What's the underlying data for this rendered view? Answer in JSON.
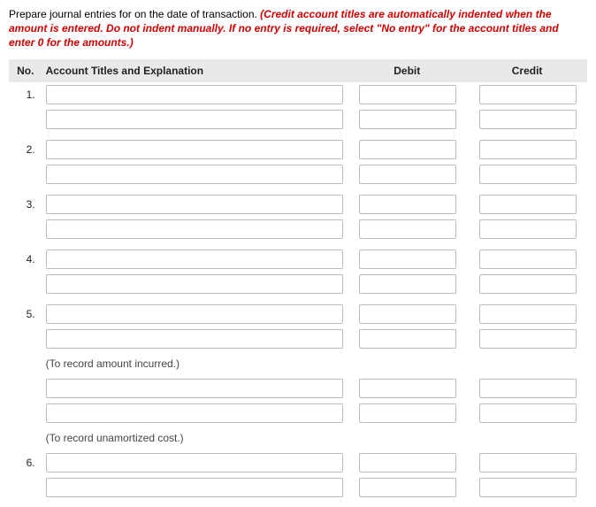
{
  "instructions": {
    "lead": "Prepare journal entries for on the date of transaction. ",
    "emph": "(Credit account titles are automatically indented when the amount is entered. Do not indent manually. If no entry is required, select \"No entry\" for the account titles and enter 0 for the amounts.)"
  },
  "headers": {
    "no": "No.",
    "account": "Account Titles and Explanation",
    "debit": "Debit",
    "credit": "Credit"
  },
  "rows": [
    {
      "no": "1.",
      "type": "entry"
    },
    {
      "type": "entry"
    },
    {
      "type": "spacer"
    },
    {
      "no": "2.",
      "type": "entry"
    },
    {
      "type": "entry"
    },
    {
      "type": "spacer"
    },
    {
      "no": "3.",
      "type": "entry"
    },
    {
      "type": "entry"
    },
    {
      "type": "spacer"
    },
    {
      "no": "4.",
      "type": "entry"
    },
    {
      "type": "entry"
    },
    {
      "type": "spacer"
    },
    {
      "no": "5.",
      "type": "entry"
    },
    {
      "type": "entry"
    },
    {
      "type": "note",
      "text": "(To record amount incurred.)"
    },
    {
      "type": "entry"
    },
    {
      "type": "entry"
    },
    {
      "type": "note",
      "text": "(To record unamortized cost.)"
    },
    {
      "no": "6.",
      "type": "entry"
    },
    {
      "type": "entry"
    }
  ]
}
